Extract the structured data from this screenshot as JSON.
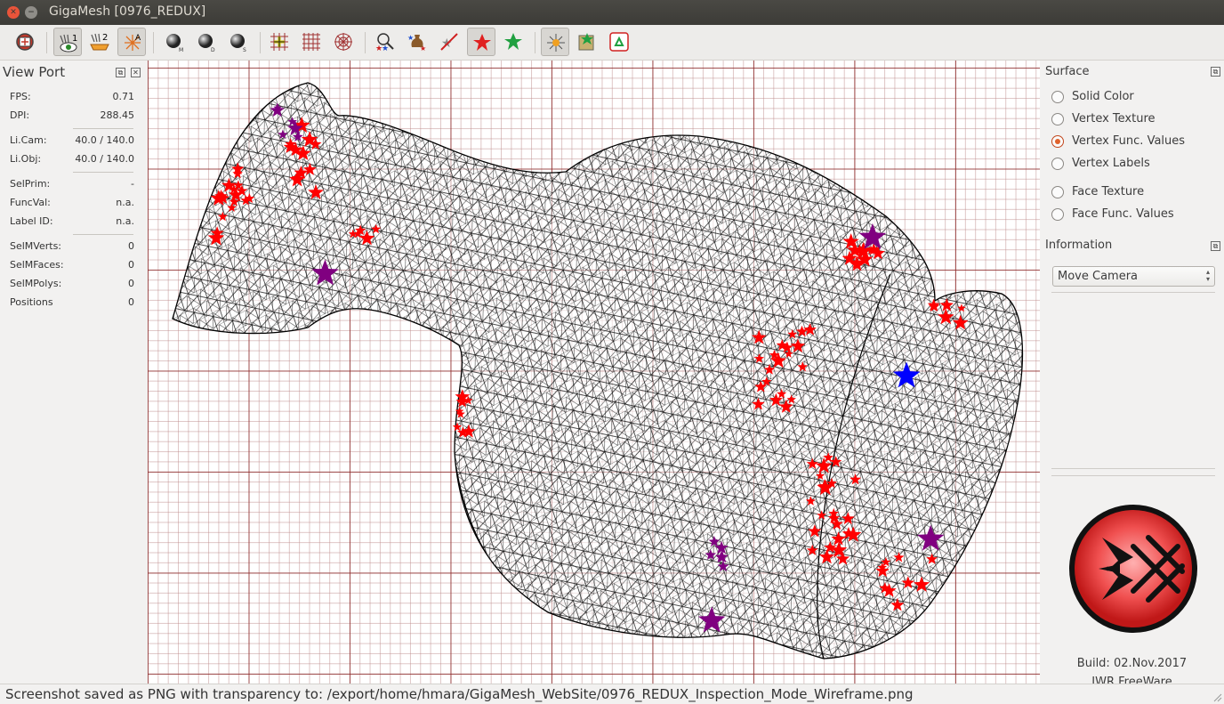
{
  "window": {
    "title": "GigaMesh [0976_REDUX]"
  },
  "toolbar": {
    "buttons": [
      {
        "icon": "exit-icon"
      },
      {
        "icon": "eye-sheet-1-icon",
        "active": true
      },
      {
        "icon": "sheet-2-icon"
      },
      {
        "icon": "light-a-icon",
        "active": true
      },
      {
        "icon": "sphere-m-icon"
      },
      {
        "icon": "sphere-d-icon"
      },
      {
        "icon": "sphere-s-icon"
      },
      {
        "icon": "grid-plus-icon"
      },
      {
        "icon": "grid-icon"
      },
      {
        "icon": "polar-grid-icon"
      },
      {
        "icon": "colorful-stars-icon"
      },
      {
        "icon": "vessel-stars-icon"
      },
      {
        "icon": "strike-icon"
      },
      {
        "icon": "red-star-icon",
        "active": true
      },
      {
        "icon": "green-star-icon"
      },
      {
        "icon": "burst-icon",
        "active": true
      },
      {
        "icon": "mesh-star-icon"
      },
      {
        "icon": "recycle-icon"
      }
    ]
  },
  "viewport": {
    "title": "View Port",
    "rows": [
      {
        "label": "FPS:",
        "value": "0.71"
      },
      {
        "label": "DPI:",
        "value": "288.45"
      },
      {
        "label": "Li.Cam:",
        "value": "40.0 / 140.0"
      },
      {
        "label": "Li.Obj:",
        "value": "40.0 / 140.0"
      },
      {
        "label": "SelPrim:",
        "value": "-"
      },
      {
        "label": "FuncVal:",
        "value": "n.a."
      },
      {
        "label": "Label ID:",
        "value": "n.a."
      },
      {
        "label": "SelMVerts:",
        "value": "0"
      },
      {
        "label": "SelMFaces:",
        "value": "0"
      },
      {
        "label": "SelMPolys:",
        "value": "0"
      },
      {
        "label": "Positions",
        "value": "0"
      }
    ]
  },
  "surface": {
    "title": "Surface",
    "options": [
      {
        "label": "Solid Color",
        "checked": false
      },
      {
        "label": "Vertex Texture",
        "checked": false
      },
      {
        "label": "Vertex Func. Values",
        "checked": true
      },
      {
        "label": "Vertex Labels",
        "checked": false
      },
      {
        "label": "Face Texture",
        "checked": false
      },
      {
        "label": "Face Func. Values",
        "checked": false
      }
    ]
  },
  "information": {
    "title": "Information",
    "mode_select": "Move Camera"
  },
  "footer": {
    "build": "Build: 02.Nov.2017",
    "license": "IWR FreeWare"
  },
  "status": {
    "message": "Screenshot saved as PNG with transparency to: /export/home/hmara/GigaMesh_WebSite/0976_REDUX_Inspection_Mode_Wireframe.png"
  },
  "colors": {
    "grid_major": "#8c2828",
    "grid_minor": "#be8c8c",
    "mesh_edge": "#000000",
    "label_red": "#ff0000",
    "label_purple": "#800080",
    "label_blue": "#0000ff",
    "radio_accent": "#e0622c",
    "logo_red": "#e8383a"
  }
}
